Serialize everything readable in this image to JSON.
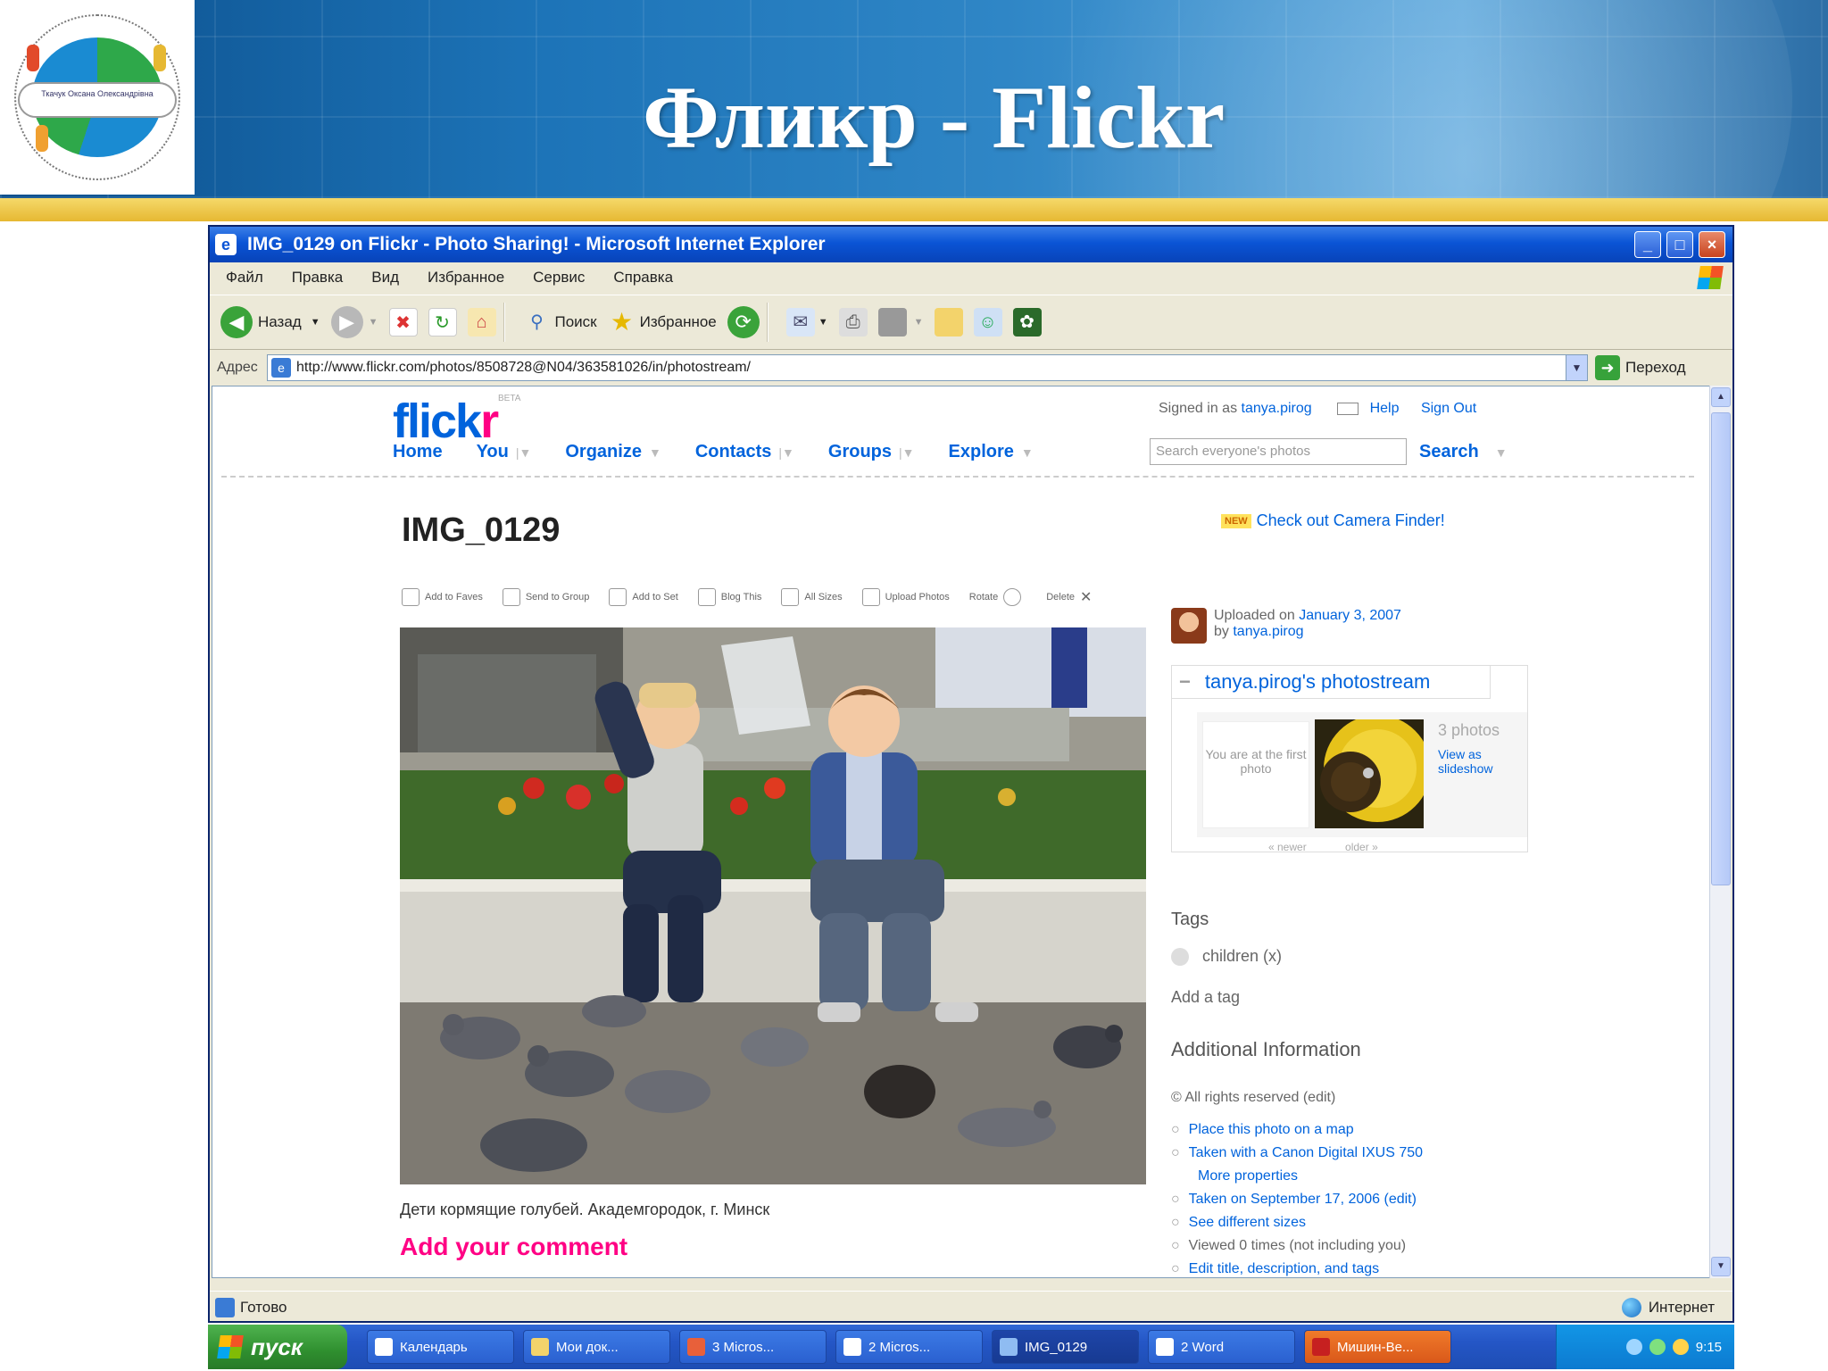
{
  "slide": {
    "title": "Фликр - Flickr",
    "logo_text": "Ткачук Оксана Олександрівна"
  },
  "window": {
    "title": "IMG_0129 on Flickr - Photo Sharing! - Microsoft Internet Explorer",
    "menu": [
      "Файл",
      "Правка",
      "Вид",
      "Избранное",
      "Сервис",
      "Справка"
    ],
    "toolbar": {
      "back": "Назад",
      "search": "Поиск",
      "favorites": "Избранное"
    },
    "address_label": "Адрес",
    "address": "http://www.flickr.com/photos/8508728@N04/363581026/in/photostream/",
    "go_label": "Переход",
    "status_left": "Готово",
    "status_right": "Интернет"
  },
  "flickr": {
    "logo_main": "flick",
    "logo_r": "r",
    "beta": "BETA",
    "signed_in_prefix": "Signed in as",
    "user": "tanya.pirog",
    "help": "Help",
    "sign_out": "Sign Out",
    "nav": [
      "Home",
      "You",
      "Organize",
      "Contacts",
      "Groups",
      "Explore"
    ],
    "search_placeholder": "Search everyone's photos",
    "search_button": "Search",
    "photo_title": "IMG_0129",
    "new_badge": "NEW",
    "camera_finder": "Check out Camera Finder!",
    "tools": [
      "Add to Faves",
      "Send to Group",
      "Add to Set",
      "Blog This",
      "All Sizes",
      "Upload Photos",
      "Rotate",
      "Delete"
    ],
    "caption": "Дети кормящие голубей. Академгородок, г. Минск",
    "add_comment": "Add your comment",
    "uploaded_prefix": "Uploaded on",
    "uploaded_date": "January 3, 2007",
    "uploaded_by_prefix": "by",
    "stream_title": "tanya.pirog's photostream",
    "stream_empty": "You are at the first photo",
    "stream_count": "3 photos",
    "stream_slideshow": "View as slideshow",
    "stream_nav_prev": "« newer",
    "stream_nav_next": "older »",
    "tags_head": "Tags",
    "tag": "children (x)",
    "add_tag": "Add a tag",
    "additional_head": "Additional Information",
    "rights": "All rights reserved (edit)",
    "info": [
      "Place this photo on a map",
      "Taken with a Canon Digital IXUS 750",
      "More properties",
      "Taken on September 17, 2006 (edit)",
      "See different sizes",
      "Viewed 0 times (not including you)",
      "Edit title, description, and tags"
    ]
  },
  "taskbar": {
    "start": "пуск",
    "tasks": [
      "Календарь",
      "Мои док...",
      "3 Micros...",
      "2 Micros...",
      "IMG_0129",
      "2 Word",
      "Мишин-Ве..."
    ],
    "clock": "9:15"
  }
}
